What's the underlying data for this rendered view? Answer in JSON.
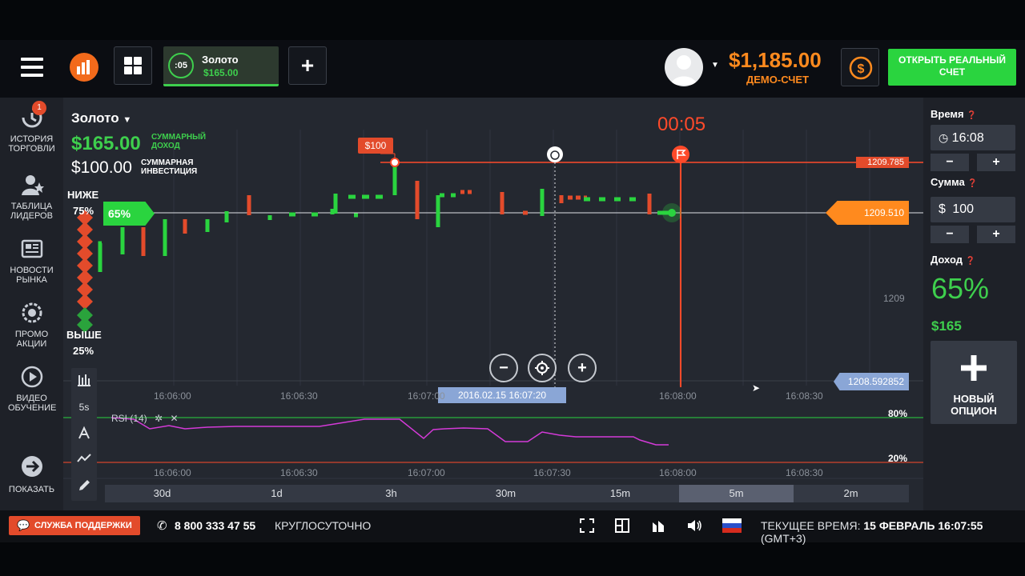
{
  "topbar": {
    "asset_tab": {
      "timer": ":05",
      "name": "Золото",
      "amount": "$165.00"
    },
    "add_label": "+",
    "balance": "$1,185.00",
    "account_type": "ДЕМО-СЧЕТ",
    "open_real_label": "ОТКРЫТЬ РЕАЛЬНЫЙ СЧЕТ"
  },
  "sidebar": {
    "badge": "1",
    "items": [
      {
        "label": "ИСТОРИЯ ТОРГОВЛИ"
      },
      {
        "label": "ТАБЛИЦА ЛИДЕРОВ"
      },
      {
        "label": "НОВОСТИ РЫНКА"
      },
      {
        "label": "ПРОМО АКЦИИ"
      },
      {
        "label": "ВИДЕО ОБУЧЕНИЕ"
      },
      {
        "label": "ПОКАЗАТЬ"
      }
    ]
  },
  "chart": {
    "asset": "Золото",
    "total_profit": "$165.00",
    "total_profit_label": "СУММАРНЫЙ ДОХОД",
    "total_investment": "$100.00",
    "total_investment_label": "СУММАРНАЯ ИНВЕСТИЦИЯ",
    "lower_label": "НИЖЕ",
    "lower_pct": "75%",
    "upper_label": "ВЫШЕ",
    "upper_pct": "25%",
    "countdown": "00:05",
    "deal_tag": "$100",
    "current_pct": "65%",
    "price_high": "1209.785",
    "price_current": "1209.510",
    "price_axis": "1209",
    "price_low": "1208.592852",
    "crosshair_time": "2016.02.15 16:07:20",
    "time_ticks": [
      "16:06:00",
      "16:06:30",
      "16:07:00",
      "16:07:30",
      "16:08:00",
      "16:08:30"
    ],
    "rsi_label": "RSI (14)",
    "rsi_high": "80%",
    "rsi_low": "20%",
    "tool_5s": "5s",
    "timeframes": [
      "30d",
      "1d",
      "3h",
      "30m",
      "15m",
      "5m",
      "2m"
    ],
    "active_timeframe": "5m"
  },
  "rpanel": {
    "time_label": "Время",
    "time_value": "16:08",
    "amount_label": "Сумма",
    "amount_value": "100",
    "currency": "$",
    "profit_label": "Доход",
    "profit_pct": "65%",
    "profit_amount": "$165",
    "minus": "−",
    "plus": "+",
    "new_option": "НОВЫЙ ОПЦИОН"
  },
  "bottombar": {
    "support": "СЛУЖБА ПОДДЕРЖКИ",
    "phone": "8 800 333 47 55",
    "hours": "КРУГЛОСУТОЧНО",
    "time_label": "ТЕКУЩЕЕ ВРЕМЯ:",
    "time_value": "15 ФЕВРАЛЬ 16:07:55",
    "tz": "(GMT+3)"
  },
  "colors": {
    "green": "#3ecf4d",
    "red": "#ff4a2a",
    "orange": "#ff8a1e",
    "panel": "#1e2128",
    "chart_bg": "#242830"
  }
}
